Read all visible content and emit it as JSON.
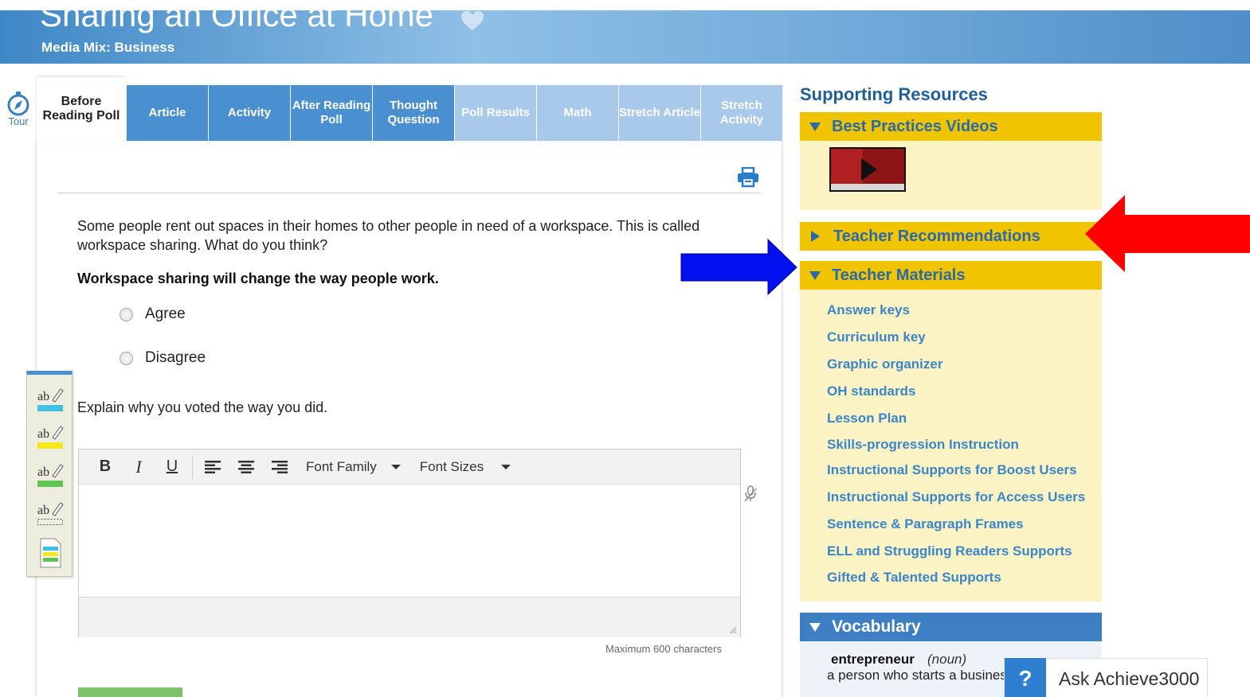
{
  "header": {
    "title": "Sharing an Office at Home",
    "subtitle": "Media Mix: Business"
  },
  "tour": {
    "label": "Tour"
  },
  "tabs": [
    {
      "label": "Before Reading Poll",
      "state": "active"
    },
    {
      "label": "Article",
      "state": "normal"
    },
    {
      "label": "Activity",
      "state": "normal"
    },
    {
      "label": "After Reading Poll",
      "state": "normal"
    },
    {
      "label": "Thought Question",
      "state": "normal"
    },
    {
      "label": "Poll Results",
      "state": "disabled"
    },
    {
      "label": "Math",
      "state": "disabled"
    },
    {
      "label": "Stretch Article",
      "state": "disabled"
    },
    {
      "label": "Stretch Activity",
      "state": "disabled"
    }
  ],
  "poll": {
    "question": "Some people rent out spaces in their homes to other people in need of a workspace. This is called workspace sharing. What do you think?",
    "statement": "Workspace sharing will change the way people work.",
    "options": [
      "Agree",
      "Disagree"
    ],
    "explain_prompt": "Explain why you voted the way you did."
  },
  "editor": {
    "bold": "B",
    "italic": "I",
    "underline": "U",
    "font_family": "Font Family",
    "font_sizes": "Font Sizes",
    "max_chars": "Maximum 600 characters"
  },
  "highlighters": [
    "blue-highlighter",
    "yellow-highlighter",
    "green-highlighter",
    "eraser-highlighter",
    "notes"
  ],
  "resources": {
    "title": "Supporting Resources",
    "best_practices": "Best Practices Videos",
    "teacher_recommendations": "Teacher Recommendations",
    "teacher_materials": "Teacher Materials",
    "materials": [
      "Answer keys",
      "Curriculum key",
      "Graphic organizer",
      "OH standards",
      "Lesson Plan",
      "Skills-progression Instruction",
      "Instructional Supports for Boost Users",
      "Instructional Supports for Access Users",
      "Sentence & Paragraph Frames",
      "ELL and Struggling Readers Supports",
      "Gifted & Talented Supports"
    ],
    "vocabulary": "Vocabulary",
    "vocab_word": "entrepreneur",
    "vocab_pos": "(noun)",
    "vocab_def": "a person who starts a business"
  },
  "help": {
    "icon": "?",
    "label": "Ask Achieve3000"
  },
  "colors": {
    "header_blue": "#4f8ec9",
    "tab_blue": "#4a8fd0",
    "accordion_yellow": "#f0c400",
    "link_blue": "#3a86c8",
    "arrow_red": "#ff0000",
    "arrow_blue": "#0010ee"
  }
}
